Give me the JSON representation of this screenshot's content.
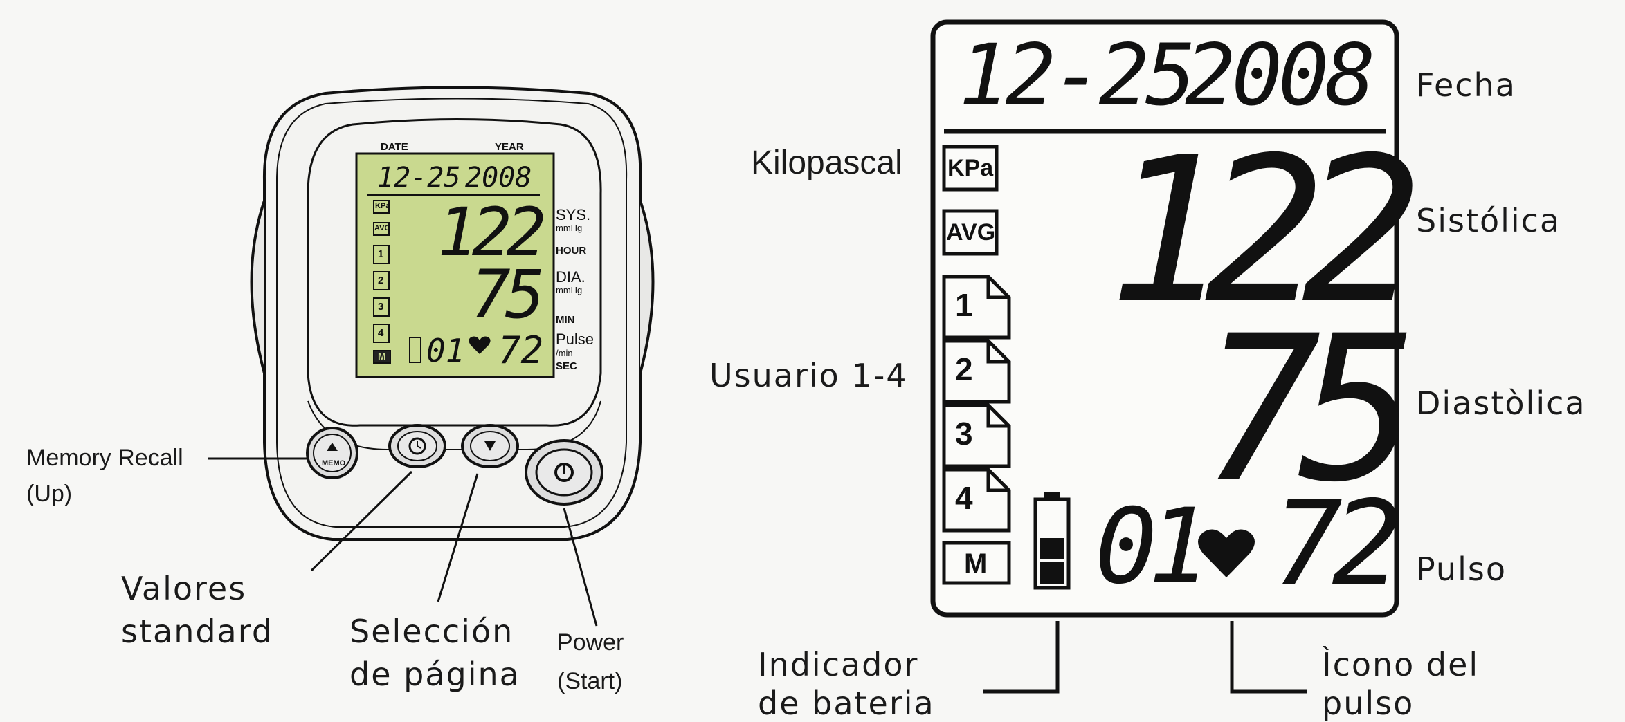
{
  "device": {
    "date_header": "DATE",
    "year_header": "YEAR",
    "lcd_date": "12-25",
    "lcd_year": "2008",
    "sys_value": "122",
    "dia_value": "75",
    "user_number": "01",
    "pulse_value": "72",
    "sys_label": "SYS.",
    "sys_unit": "mmHg",
    "hour_label": "HOUR",
    "dia_label": "DIA.",
    "dia_unit": "mmHg",
    "min_label": "MIN",
    "pulse_label": "Pulse",
    "pulse_unit": "/min",
    "sec_label": "SEC",
    "icons": {
      "kpa": "KPa",
      "avg": "AVG",
      "user1": "1",
      "user2": "2",
      "user3": "3",
      "user4": "4",
      "memory": "M"
    },
    "memo_button": "MEMO",
    "lcd_color": "#c9d98f"
  },
  "display": {
    "date": "12-25",
    "year": "2008",
    "systolic": "122",
    "diastolic": "75",
    "user_number": "01",
    "pulse": "72",
    "icons": {
      "kpa": "KPa",
      "avg": "AVG",
      "user1": "1",
      "user2": "2",
      "user3": "3",
      "user4": "4",
      "memory": "M"
    }
  },
  "callouts": {
    "memory_recall": "Memory Recall",
    "memory_recall_sub": "(Up)",
    "valores_1": "Valores",
    "valores_2": "standard",
    "seleccion_1": "Selección",
    "seleccion_2": "de página",
    "power_1": "Power",
    "power_2": "(Start)",
    "kilopascal": "Kilopascal",
    "usuario": "Usuario 1-4",
    "indicador_1": "Indicador",
    "indicador_2": "de bateria",
    "fecha": "Fecha",
    "sistolica": "Sistólica",
    "diastolica": "Diastòlica",
    "pulso": "Pulso",
    "icono_1": "Ìcono del",
    "icono_2": "pulso"
  }
}
